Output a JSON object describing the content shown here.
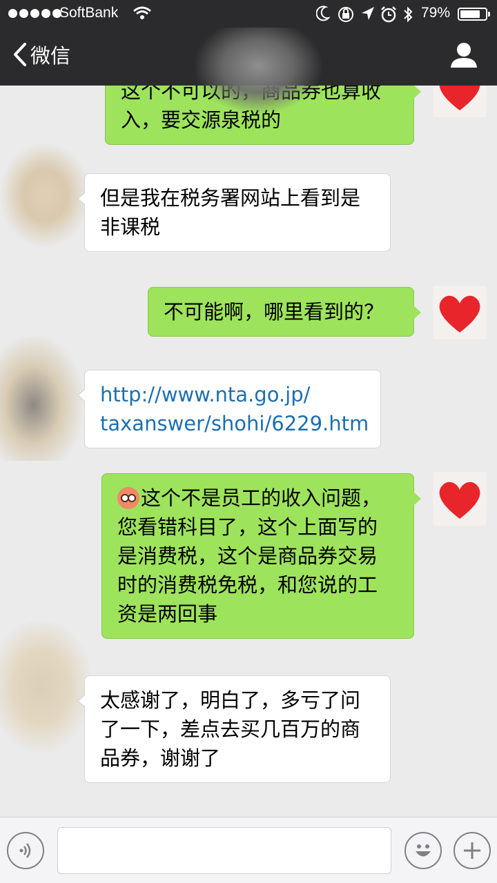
{
  "status_bar": {
    "carrier": "SoftBank",
    "battery_percent": "79%",
    "battery_level": 0.79,
    "icons": [
      "signal-dots-icon",
      "wifi-icon",
      "moon-icon",
      "rotation-lock-icon",
      "location-arrow-icon",
      "alarm-icon",
      "bluetooth-icon",
      "battery-icon"
    ]
  },
  "nav": {
    "back_label": "微信",
    "back_icon": "chevron-left-icon",
    "right_icon": "contact-profile-icon"
  },
  "messages": [
    {
      "side": "out",
      "text": "这个不可以的，商品券也算收\n入，要交源泉税的",
      "avatar": "heart-avatar"
    },
    {
      "side": "in",
      "text": "但是我在税务署网站上看到是\n非课税",
      "avatar": "blurred-avatar"
    },
    {
      "side": "out",
      "text": "不可能啊，哪里看到的？",
      "avatar": "heart-avatar"
    },
    {
      "side": "in",
      "text": "http://www.nta.go.jp/\ntaxanswer/shohi/6229.htm",
      "avatar": "blurred-avatar",
      "is_link": true
    },
    {
      "side": "out",
      "emoji": "blushing-face-emoji",
      "text": "这个不是员工的收入问题，\n您看错科目了，这个上面写的\n是消费税，这个是商品券交易\n时的消费税免税，和您说的工\n资是两回事",
      "avatar": "heart-avatar"
    },
    {
      "side": "in",
      "text": "太感谢了，明白了，多亏了问\n了一下，差点去买几百万的商\n品券，谢谢了",
      "avatar": "blurred-avatar"
    }
  ],
  "input_bar": {
    "voice_icon": "voice-input-icon",
    "input_value": "",
    "emoji_icon": "emoji-smiley-icon",
    "plus_icon": "plus-icon"
  },
  "colors": {
    "nav_background": "#2b2b2d",
    "chat_background": "#ebebeb",
    "outgoing_bubble": "#9ee35c",
    "incoming_bubble": "#ffffff",
    "link": "#1d6fae",
    "heart": "#e8252a"
  }
}
